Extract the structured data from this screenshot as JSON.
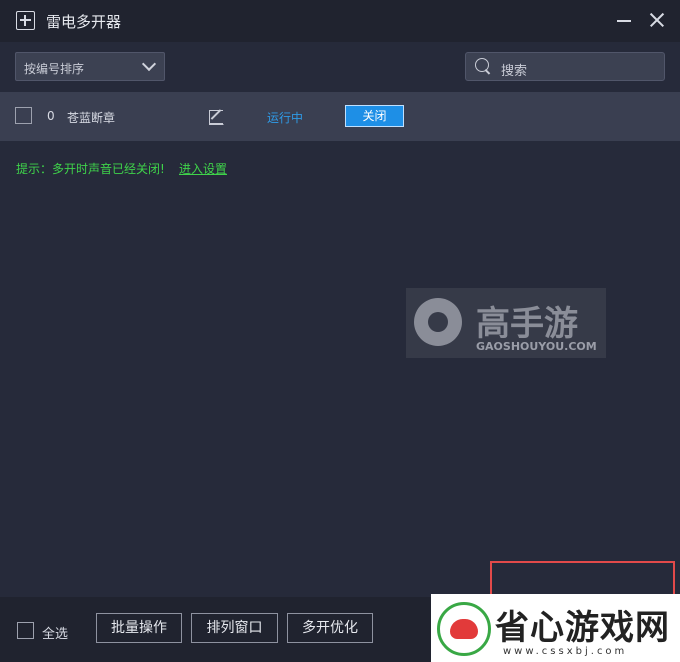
{
  "window": {
    "title": "雷电多开器"
  },
  "toolbar": {
    "sort_selected": "按编号排序",
    "search_placeholder": "搜索"
  },
  "instances": [
    {
      "index": "0",
      "name": "苍蓝断章",
      "status": "运行中",
      "action_label": "关闭"
    }
  ],
  "hint": {
    "text": "提示：多开时声音已经关闭!",
    "link": "进入设置"
  },
  "footer": {
    "select_all_label": "全选",
    "batch_label": "批量操作",
    "arrange_label": "排列窗口",
    "optimize_label": "多开优化"
  },
  "watermark": {
    "main": "高手游",
    "sub": "GAOSHOUYOU.COM"
  },
  "badge": {
    "text": "省心游戏网",
    "url": "www.cssxbj.com"
  },
  "colors": {
    "background": "#262a3a",
    "row": "#3a3f51",
    "accent_blue": "#1e8fe6",
    "status_blue": "#2f9ae6",
    "hint_green": "#3fd34a"
  },
  "icons": {
    "app": "add-window-icon",
    "search": "search-icon",
    "edit": "edit-icon",
    "dropdown": "chevron-down-icon",
    "minimize": "minimize-icon",
    "close": "close-icon"
  }
}
